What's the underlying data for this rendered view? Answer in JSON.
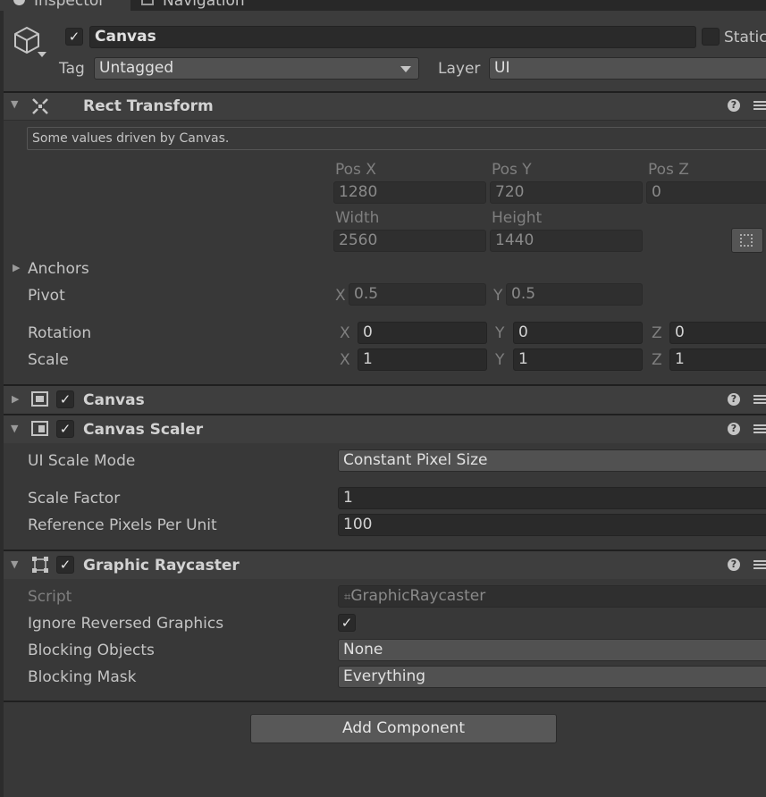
{
  "tabs": {
    "inspector": "Inspector",
    "navigation": "Navigation"
  },
  "header": {
    "name": "Canvas",
    "static_label": "Static",
    "tag_label": "Tag",
    "tag_value": "Untagged",
    "layer_label": "Layer",
    "layer_value": "UI",
    "active": true
  },
  "rect_transform": {
    "title": "Rect Transform",
    "info": "Some values driven by Canvas.",
    "pos_x_label": "Pos X",
    "pos_y_label": "Pos Y",
    "pos_z_label": "Pos Z",
    "pos_x": "1280",
    "pos_y": "720",
    "pos_z": "0",
    "width_label": "Width",
    "height_label": "Height",
    "width": "2560",
    "height": "1440",
    "anchors_label": "Anchors",
    "pivot_label": "Pivot",
    "pivot_x": "0.5",
    "pivot_y": "0.5",
    "rotation_label": "Rotation",
    "rot_x": "0",
    "rot_y": "0",
    "rot_z": "0",
    "scale_label": "Scale",
    "scale_x": "1",
    "scale_y": "1",
    "scale_z": "1",
    "axis_x": "X",
    "axis_y": "Y",
    "axis_z": "Z"
  },
  "canvas": {
    "title": "Canvas",
    "enabled": true
  },
  "canvas_scaler": {
    "title": "Canvas Scaler",
    "enabled": true,
    "ui_scale_mode_label": "UI Scale Mode",
    "ui_scale_mode": "Constant Pixel Size",
    "scale_factor_label": "Scale Factor",
    "scale_factor": "1",
    "ref_ppu_label": "Reference Pixels Per Unit",
    "ref_ppu": "100"
  },
  "graphic_raycaster": {
    "title": "Graphic Raycaster",
    "enabled": true,
    "script_label": "Script",
    "script_value": "GraphicRaycaster",
    "ignore_reversed_label": "Ignore Reversed Graphics",
    "ignore_reversed": true,
    "blocking_objects_label": "Blocking Objects",
    "blocking_objects": "None",
    "blocking_mask_label": "Blocking Mask",
    "blocking_mask": "Everything"
  },
  "add_component": "Add Component",
  "icons": {
    "help": "?",
    "check": "✓"
  }
}
